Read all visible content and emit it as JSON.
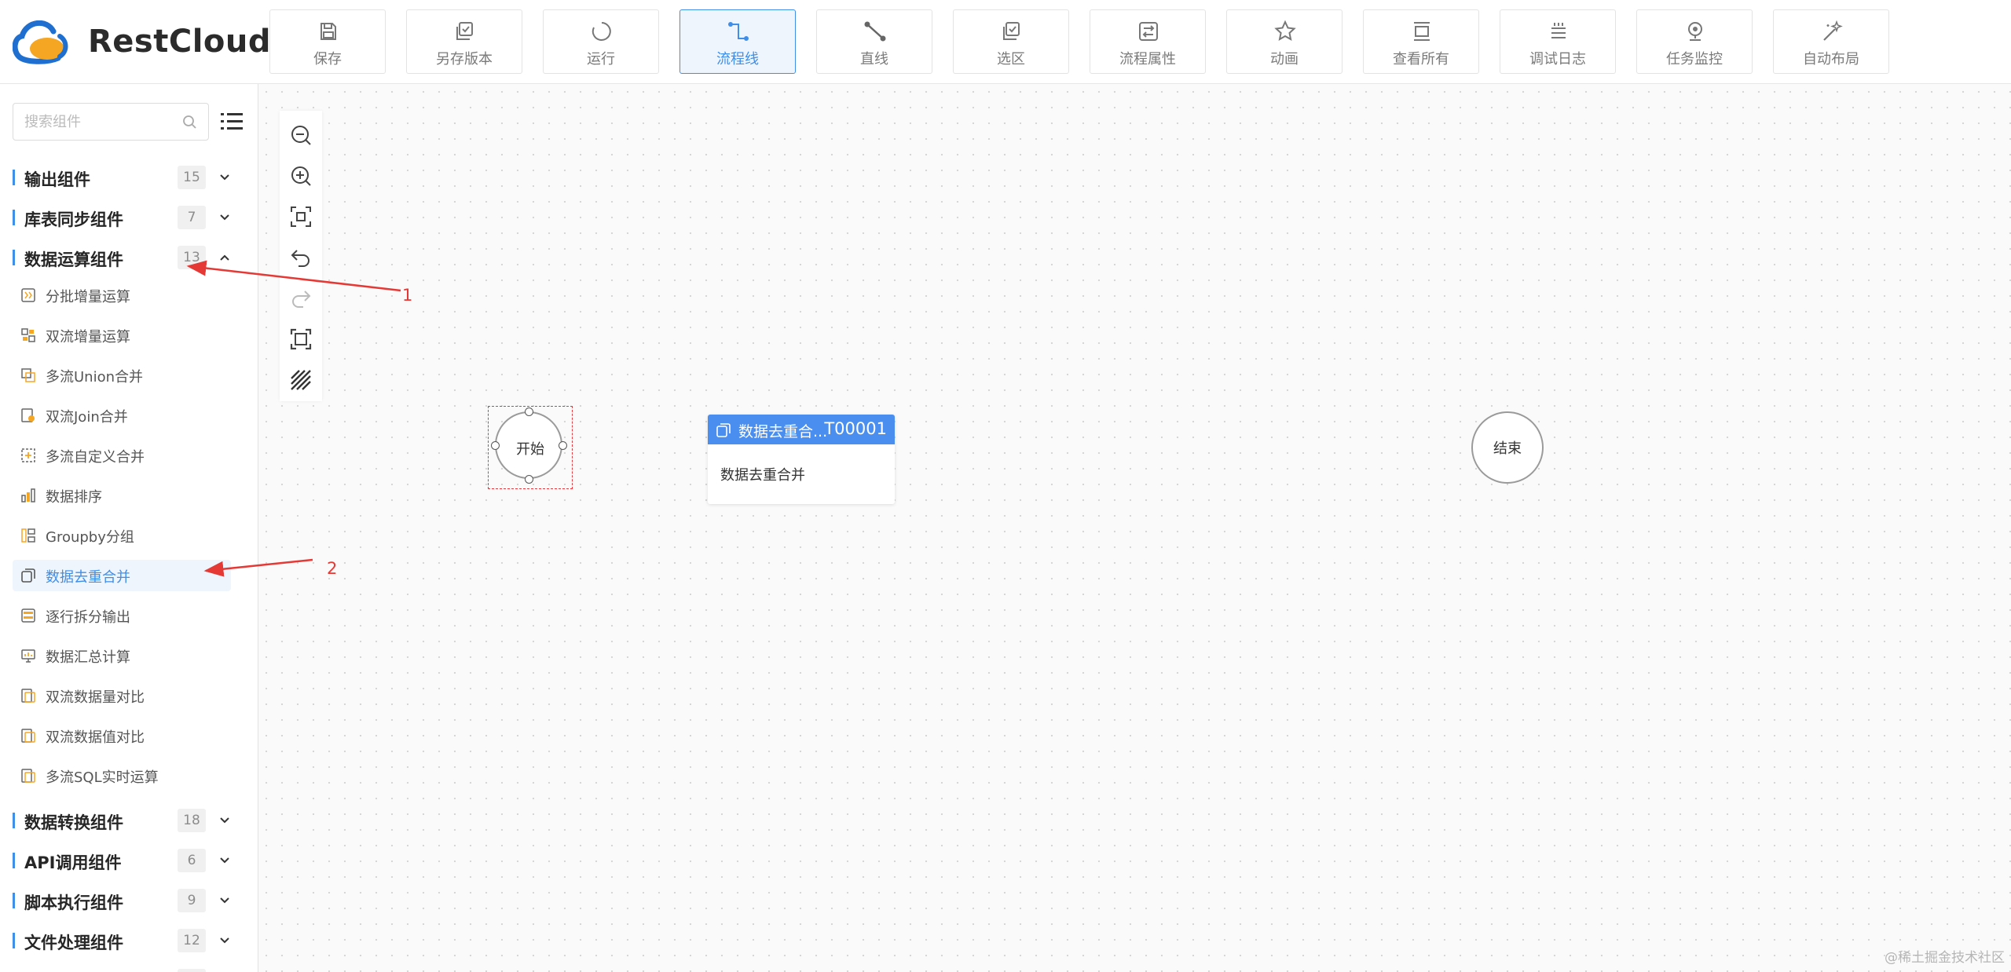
{
  "app": {
    "name": "RestCloud"
  },
  "toolbar": [
    {
      "label": "保存",
      "icon": "save-icon"
    },
    {
      "label": "另存版本",
      "icon": "save-version-icon"
    },
    {
      "label": "运行",
      "icon": "run-icon"
    },
    {
      "label": "流程线",
      "icon": "flow-line-icon",
      "active": true
    },
    {
      "label": "直线",
      "icon": "straight-line-icon"
    },
    {
      "label": "选区",
      "icon": "select-area-icon"
    },
    {
      "label": "流程属性",
      "icon": "flow-properties-icon"
    },
    {
      "label": "动画",
      "icon": "animation-icon"
    },
    {
      "label": "查看所有",
      "icon": "view-all-icon"
    },
    {
      "label": "调试日志",
      "icon": "debug-log-icon"
    },
    {
      "label": "任务监控",
      "icon": "task-monitor-icon"
    },
    {
      "label": "自动布局",
      "icon": "auto-layout-icon"
    }
  ],
  "search": {
    "placeholder": "搜索组件"
  },
  "categories": [
    {
      "label": "输出组件",
      "count": "15",
      "expanded": false
    },
    {
      "label": "库表同步组件",
      "count": "7",
      "expanded": false
    },
    {
      "label": "数据运算组件",
      "count": "13",
      "expanded": true
    },
    {
      "label": "数据转换组件",
      "count": "18",
      "expanded": false
    },
    {
      "label": "API调用组件",
      "count": "6",
      "expanded": false
    },
    {
      "label": "脚本执行组件",
      "count": "9",
      "expanded": false
    },
    {
      "label": "文件处理组件",
      "count": "12",
      "expanded": false
    }
  ],
  "operation_items": [
    {
      "label": "分批增量运算"
    },
    {
      "label": "双流增量运算"
    },
    {
      "label": "多流Union合并"
    },
    {
      "label": "双流Join合并"
    },
    {
      "label": "多流自定义合并"
    },
    {
      "label": "数据排序"
    },
    {
      "label": "Groupby分组"
    },
    {
      "label": "数据去重合并",
      "selected": true
    },
    {
      "label": "逐行拆分输出"
    },
    {
      "label": "数据汇总计算"
    },
    {
      "label": "双流数据量对比"
    },
    {
      "label": "双流数据值对比"
    },
    {
      "label": "多流SQL实时运算"
    }
  ],
  "canvas": {
    "start_node": {
      "label": "开始"
    },
    "end_node": {
      "label": "结束"
    },
    "task_node": {
      "title": "数据去重合...",
      "id": "T00001",
      "body": "数据去重合并"
    }
  },
  "annotations": {
    "one": "1",
    "two": "2"
  },
  "watermark": "@稀土掘金技术社区",
  "colors": {
    "accent": "#3f8ee8",
    "node_header": "#4a8ff0",
    "annotation": "#e53935"
  }
}
